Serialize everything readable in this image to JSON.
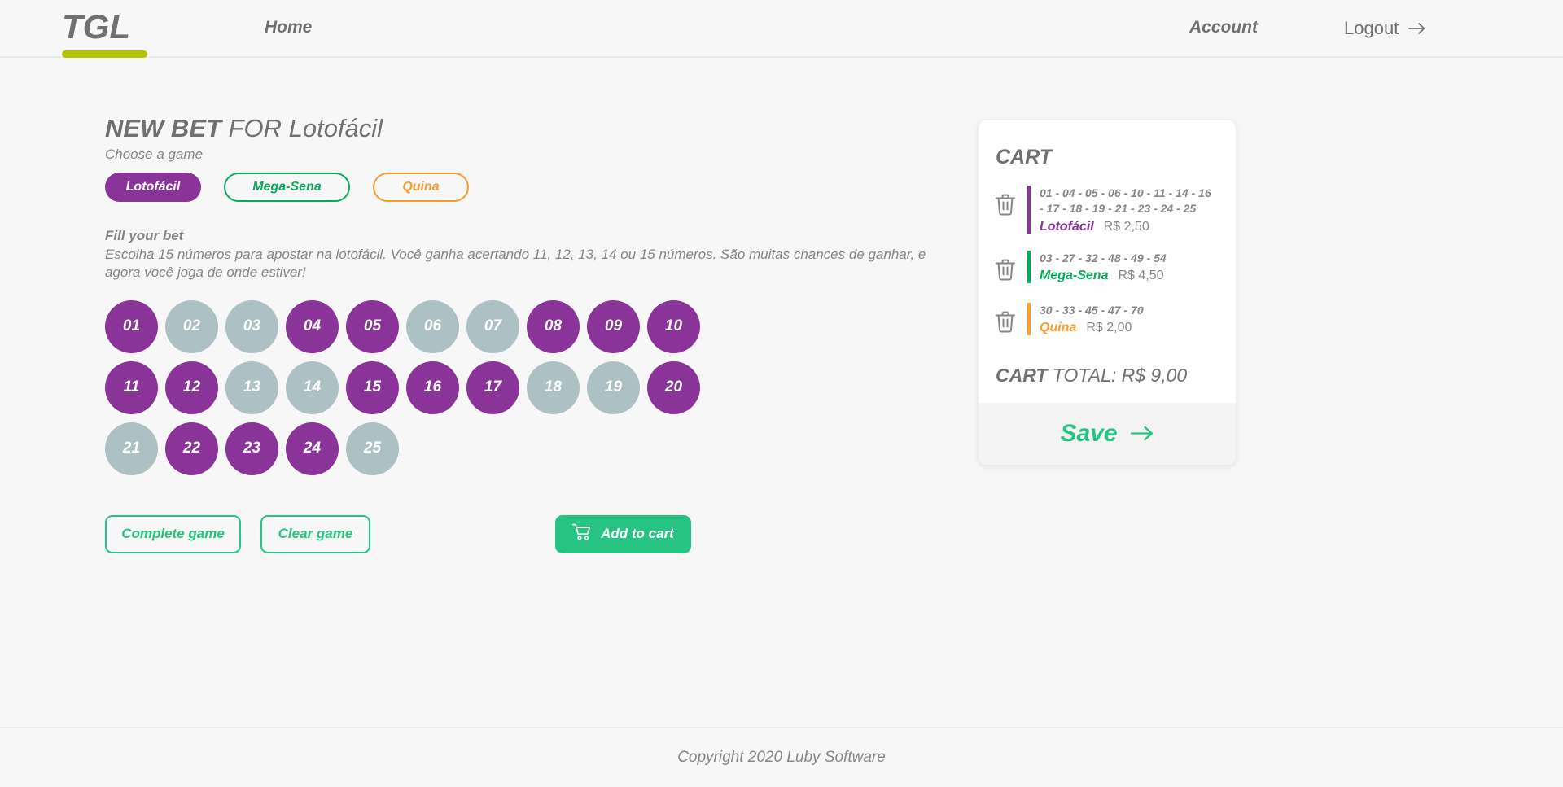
{
  "header": {
    "logo": "TGL",
    "nav_home": "Home",
    "nav_account": "Account",
    "nav_logout": "Logout",
    "logout_icon": "arrow-right-icon",
    "accent_underline": "#b5c401"
  },
  "bet": {
    "title_bold": "NEW BET",
    "title_rest": " FOR Lotofácil",
    "subtitle": "Choose a game",
    "game_types": [
      {
        "label": "Lotofácil",
        "color": "#8a3398",
        "selected": true
      },
      {
        "label": "Mega-Sena",
        "color": "#0ba95b",
        "selected": false
      },
      {
        "label": "Quina",
        "color": "#f79c31",
        "selected": false
      }
    ],
    "fill_label": "Fill your bet",
    "fill_description": "Escolha 15 números para apostar na lotofácil. Você ganha acertando 11, 12, 13, 14 ou 15 números. São muitas chances de ganhar, e agora você joga de onde estiver!",
    "numbers": [
      {
        "label": "01",
        "selected": true
      },
      {
        "label": "02",
        "selected": false
      },
      {
        "label": "03",
        "selected": false
      },
      {
        "label": "04",
        "selected": true
      },
      {
        "label": "05",
        "selected": true
      },
      {
        "label": "06",
        "selected": false
      },
      {
        "label": "07",
        "selected": false
      },
      {
        "label": "08",
        "selected": true
      },
      {
        "label": "09",
        "selected": true
      },
      {
        "label": "10",
        "selected": true
      },
      {
        "label": "11",
        "selected": true
      },
      {
        "label": "12",
        "selected": true
      },
      {
        "label": "13",
        "selected": false
      },
      {
        "label": "14",
        "selected": false
      },
      {
        "label": "15",
        "selected": true
      },
      {
        "label": "16",
        "selected": true
      },
      {
        "label": "17",
        "selected": true
      },
      {
        "label": "18",
        "selected": false
      },
      {
        "label": "19",
        "selected": false
      },
      {
        "label": "20",
        "selected": true
      },
      {
        "label": "21",
        "selected": false
      },
      {
        "label": "22",
        "selected": true
      },
      {
        "label": "23",
        "selected": true
      },
      {
        "label": "24",
        "selected": true
      },
      {
        "label": "25",
        "selected": false
      }
    ],
    "selected_color": "#8a3398",
    "unselected_color": "#adc0c4",
    "actions": {
      "complete_game": "Complete game",
      "clear_game": "Clear game",
      "add_to_cart": "Add to cart",
      "cart_icon": "shopping-cart-icon"
    }
  },
  "cart": {
    "title": "CART",
    "items": [
      {
        "numbers": "01 - 04 - 05 - 06 - 10 - 11 - 14 - 16 - 17 - 18 - 19 - 21 - 23 - 24 - 25",
        "game": "Lotofácil",
        "price": "R$ 2,50",
        "color": "#8a3398"
      },
      {
        "numbers": "03 - 27 - 32 - 48 - 49 - 54",
        "game": "Mega-Sena",
        "price": "R$ 4,50",
        "color": "#0ba95b"
      },
      {
        "numbers": "30 - 33 - 45 - 47 - 70",
        "game": "Quina",
        "price": "R$ 2,00",
        "color": "#f79c31"
      }
    ],
    "delete_icon": "trash-icon",
    "total_bold": "CART",
    "total_rest": " TOTAL: R$ 9,00",
    "save_label": "Save",
    "save_icon": "arrow-right-icon",
    "save_color": "#27c383"
  },
  "footer": {
    "copyright": "Copyright 2020 Luby Software"
  }
}
